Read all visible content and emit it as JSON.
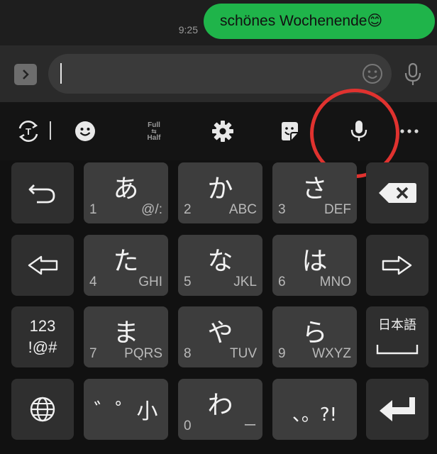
{
  "chat": {
    "time": "9:25",
    "message": "schönes Wochenende😊"
  },
  "toolbar": {
    "full_label": "Full",
    "half_label": "Half"
  },
  "keys": {
    "row1": [
      {
        "kana": "あ",
        "num": "1",
        "sub": "@/:"
      },
      {
        "kana": "か",
        "num": "2",
        "sub": "ABC"
      },
      {
        "kana": "さ",
        "num": "3",
        "sub": "DEF"
      }
    ],
    "row2": [
      {
        "kana": "た",
        "num": "4",
        "sub": "GHI"
      },
      {
        "kana": "な",
        "num": "5",
        "sub": "JKL"
      },
      {
        "kana": "は",
        "num": "6",
        "sub": "MNO"
      }
    ],
    "row3": [
      {
        "kana": "ま",
        "num": "7",
        "sub": "PQRS"
      },
      {
        "kana": "や",
        "num": "8",
        "sub": "TUV"
      },
      {
        "kana": "ら",
        "num": "9",
        "sub": "WXYZ"
      }
    ],
    "row4": {
      "dakuten": "゛゜小",
      "wa_kana": "わ",
      "wa_num": "0",
      "wa_sub": "ー",
      "punct": "、。?!"
    },
    "symbols_line1": "123",
    "symbols_line2": "!@#",
    "space_label": "日本語"
  },
  "colors": {
    "bubble": "#1fb44a",
    "annotation": "#e0322f",
    "key": "#3d3d3d",
    "side_key": "#2f2f2f"
  },
  "icons": [
    "chevron-right-icon",
    "smiley-icon",
    "mic-icon",
    "translate-icon",
    "emoji-icon",
    "gear-icon",
    "sticker-icon",
    "more-icon",
    "undo-icon",
    "backspace-icon",
    "arrow-left-icon",
    "arrow-right-icon",
    "globe-icon",
    "enter-icon"
  ]
}
